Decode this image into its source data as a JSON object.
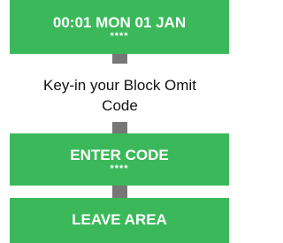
{
  "colors": {
    "box_green": "#3bb95a",
    "connector_grey": "#777777",
    "text_white": "#ffffff",
    "text_dark": "#111111"
  },
  "display": {
    "time_date": "00:01 MON 01 JAN",
    "masked": "****"
  },
  "prompt": {
    "text": "Key-in your Block Omit\nCode"
  },
  "enter_code": {
    "label": "ENTER CODE",
    "masked": "****"
  },
  "leave_area": {
    "label": "LEAVE AREA"
  }
}
